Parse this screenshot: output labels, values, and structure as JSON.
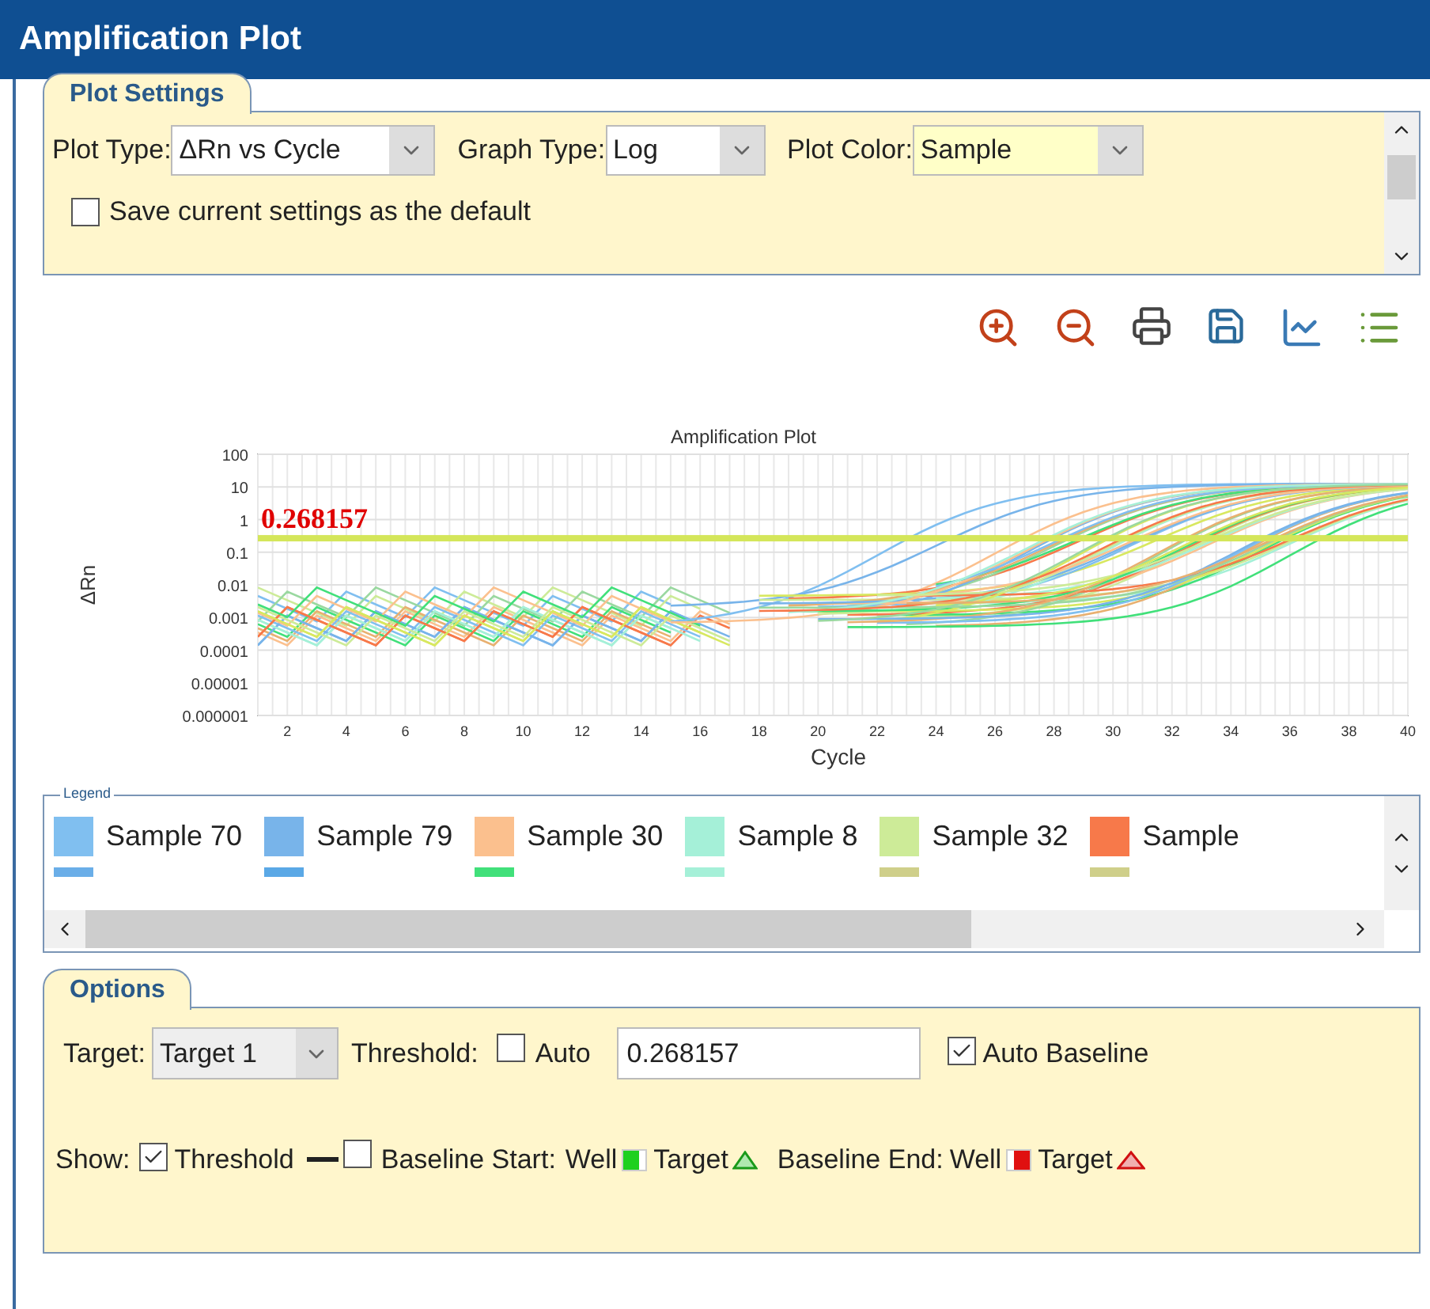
{
  "window": {
    "title": "Amplification Plot"
  },
  "plot_settings": {
    "tab": "Plot Settings",
    "selects": [
      {
        "label": "Plot Type:",
        "value": "ΔRn vs Cycle",
        "highlighted": false
      },
      {
        "label": "Graph Type:",
        "value": "Log",
        "highlighted": false
      },
      {
        "label": "Plot Color:",
        "value": "Sample",
        "highlighted": true
      }
    ],
    "save_default": {
      "label": "Save current settings as the default",
      "checked": false
    }
  },
  "chart": {
    "title": "Amplification Plot",
    "xlabel": "Cycle",
    "ylabel": "ΔRn",
    "threshold_label": "0.268157",
    "yticks": [
      "100",
      "10",
      "1",
      "0.1",
      "0.01",
      "0.001",
      "0.0001",
      "0.00001",
      "0.000001"
    ],
    "xticks": [
      "2",
      "4",
      "6",
      "8",
      "10",
      "12",
      "14",
      "16",
      "18",
      "20",
      "22",
      "24",
      "26",
      "28",
      "30",
      "32",
      "34",
      "36",
      "38",
      "40"
    ]
  },
  "legend": {
    "title": "Legend",
    "items": [
      {
        "label": "Sample 70",
        "color": "#80bff0"
      },
      {
        "label": "Sample 79",
        "color": "#78b4ea"
      },
      {
        "label": "Sample 30",
        "color": "#fbc08e"
      },
      {
        "label": "Sample 8",
        "color": "#a5f0d8"
      },
      {
        "label": "Sample 32",
        "color": "#cdeb98"
      },
      {
        "label": "Sample",
        "color": "#f7794a"
      }
    ],
    "partial_items": [
      {
        "color": "#6aaee8"
      },
      {
        "color": "#5aa8e6"
      },
      {
        "color": "#41e07a"
      },
      {
        "color": "#a5f0d8"
      },
      {
        "color": "#cfcf8a"
      },
      {
        "color": "#cfcf8a"
      }
    ]
  },
  "options": {
    "tab": "Options",
    "target_label": "Target:",
    "target_value": "Target 1",
    "threshold_label": "Threshold:",
    "auto": {
      "label": "Auto",
      "checked": false
    },
    "threshold_value": "0.268157",
    "auto_baseline": {
      "label": "Auto Baseline",
      "checked": true
    },
    "show_label": "Show:",
    "show_threshold": {
      "label": "Threshold",
      "checked": true
    },
    "show_baseline": {
      "label": "Baseline Start:",
      "checked": false
    },
    "start_well": "Well",
    "start_target": "Target",
    "end_label": "Baseline End:",
    "end_well": "Well",
    "end_target": "Target"
  }
}
